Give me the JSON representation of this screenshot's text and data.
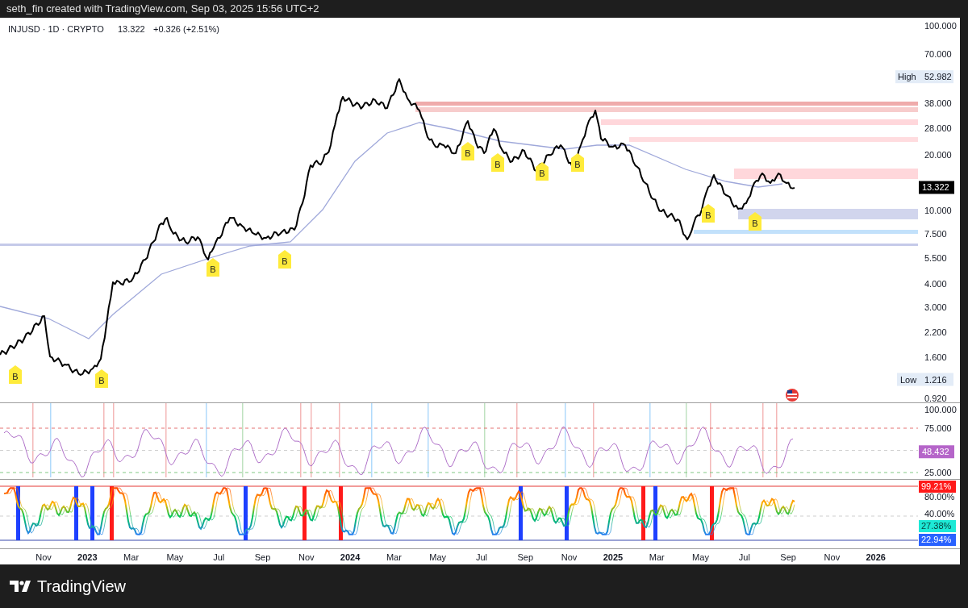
{
  "header": {
    "text": "seth_fin created with TradingView.com, Sep 03, 2025 15:56 UTC+2"
  },
  "legend": {
    "symbol": "INJUSD · 1D · CRYPTO",
    "price": "13.322",
    "change": "+0.326 (+2.51%)"
  },
  "price_pane": {
    "axis_labels": [
      "100.000",
      "70.000",
      "38.000",
      "28.000",
      "20.000",
      "10.000",
      "7.500",
      "5.500",
      "4.000",
      "3.000",
      "2.200",
      "1.600",
      "0.920"
    ],
    "markers": [
      "B",
      "B",
      "B",
      "B",
      "B",
      "B",
      "B",
      "B",
      "B",
      "B"
    ],
    "high": {
      "label": "High",
      "value": "52.982"
    },
    "low": {
      "label": "Low",
      "value": "1.216"
    },
    "last_price": "13.322"
  },
  "rsi_pane": {
    "axis_labels": [
      "100.000",
      "75.000",
      "25.000"
    ],
    "reading": "48.432"
  },
  "stoch_pane": {
    "axis_labels": [
      "80.00%",
      "40.00%"
    ],
    "readings": [
      {
        "value": "99.21%",
        "color": "#ff1a1a"
      },
      {
        "value": "27.38%",
        "color": "#1de9d6"
      },
      {
        "value": "22.94%",
        "color": "#2962ff"
      }
    ]
  },
  "time_axis": [
    {
      "label": "Nov",
      "kind": "month"
    },
    {
      "label": "2023",
      "kind": "year"
    },
    {
      "label": "Mar",
      "kind": "month"
    },
    {
      "label": "May",
      "kind": "month"
    },
    {
      "label": "Jul",
      "kind": "month"
    },
    {
      "label": "Sep",
      "kind": "month"
    },
    {
      "label": "Nov",
      "kind": "month"
    },
    {
      "label": "2024",
      "kind": "year"
    },
    {
      "label": "Mar",
      "kind": "month"
    },
    {
      "label": "May",
      "kind": "month"
    },
    {
      "label": "Jul",
      "kind": "month"
    },
    {
      "label": "Sep",
      "kind": "month"
    },
    {
      "label": "Nov",
      "kind": "month"
    },
    {
      "label": "2025",
      "kind": "year"
    },
    {
      "label": "Mar",
      "kind": "month"
    },
    {
      "label": "May",
      "kind": "month"
    },
    {
      "label": "Jul",
      "kind": "month"
    },
    {
      "label": "Sep",
      "kind": "month"
    },
    {
      "label": "Nov",
      "kind": "month"
    },
    {
      "label": "2026",
      "kind": "year"
    }
  ],
  "footer": {
    "brand": "TradingView"
  }
}
